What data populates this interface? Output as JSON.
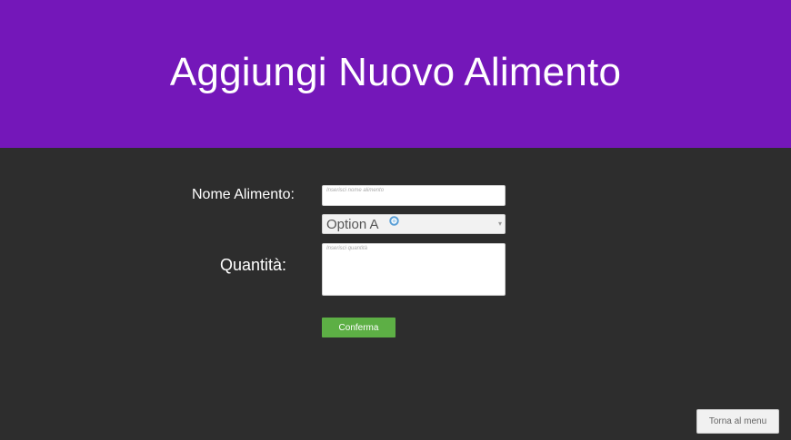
{
  "header": {
    "title": "Aggiungi Nuovo Alimento",
    "background": "#7417b9"
  },
  "form": {
    "name_label": "Nome Alimento:",
    "name_placeholder": "Inserisci nome alimento",
    "category_select": {
      "value": "Option A"
    },
    "quantity_label": "Quantità:",
    "quantity_placeholder": "Inserisci quantità",
    "confirm_label": "Conferma",
    "confirm_color": "#5daf45"
  },
  "footer": {
    "back_label": "Torna al menu"
  },
  "colors": {
    "background": "#2d2d2d"
  }
}
